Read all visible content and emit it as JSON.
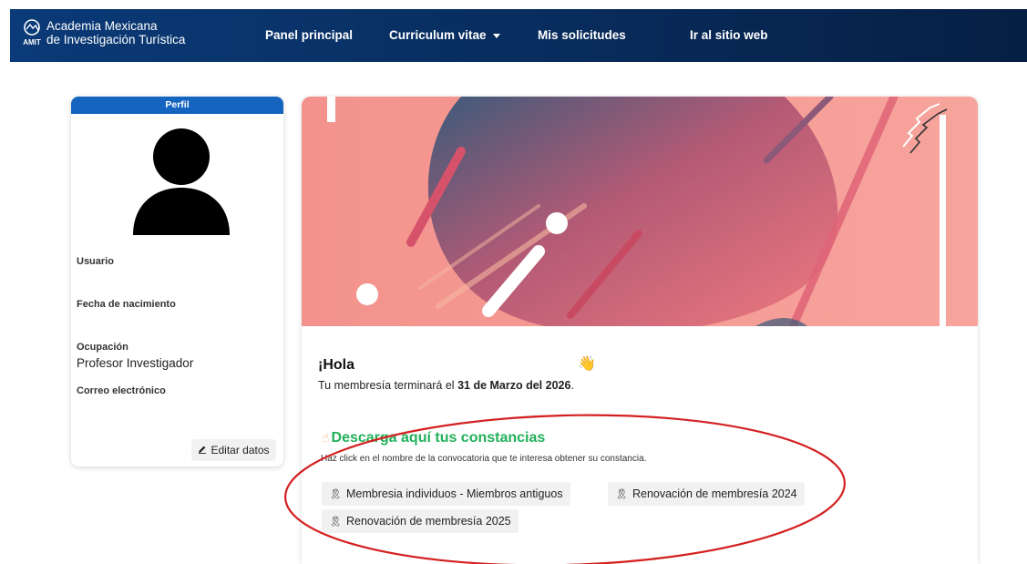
{
  "navbar": {
    "brand_line1": "Academia Mexicana",
    "brand_line2": "de Investigación Turística",
    "logo_text": "AMIT",
    "links": {
      "panel": "Panel principal",
      "cv": "Curriculum vitae",
      "solicitudes": "Mis solicitudes",
      "sitio": "Ir al sitio web"
    }
  },
  "profile": {
    "header": "Perfil",
    "usuario_label": "Usuario",
    "fecha_label": "Fecha de nacimiento",
    "ocupacion_label": "Ocupación",
    "ocupacion_value": "Profesor Investigador",
    "correo_label": "Correo electrónico",
    "edit_label": "Editar datos"
  },
  "main": {
    "hello": "¡Hola",
    "wave_emoji": "👋",
    "membership_prefix": "Tu membresía terminará el ",
    "membership_date": "31 de Marzo del 2026",
    "membership_suffix": ".",
    "download_title": "Descarga aquí tus constancias",
    "download_subtitle": "Haz click en el nombre de la convocatoria que te interesa obtener su constancia.",
    "certificates": [
      "Membresia individuos - Miembros antiguos",
      "Renovación de membresía 2024",
      "Renovación de membresía 2025"
    ]
  },
  "colors": {
    "navbar": "#082c5c",
    "profile_header": "#1565c0",
    "download_title": "#21b05a",
    "annotation_ellipse": "#d42020",
    "banner_bg": "#f29a93"
  },
  "icons": {
    "brand": "amit-logo-icon",
    "edit": "pencil-icon",
    "certificate": "award-ribbon-icon",
    "download": "hand-pointer-icon"
  }
}
